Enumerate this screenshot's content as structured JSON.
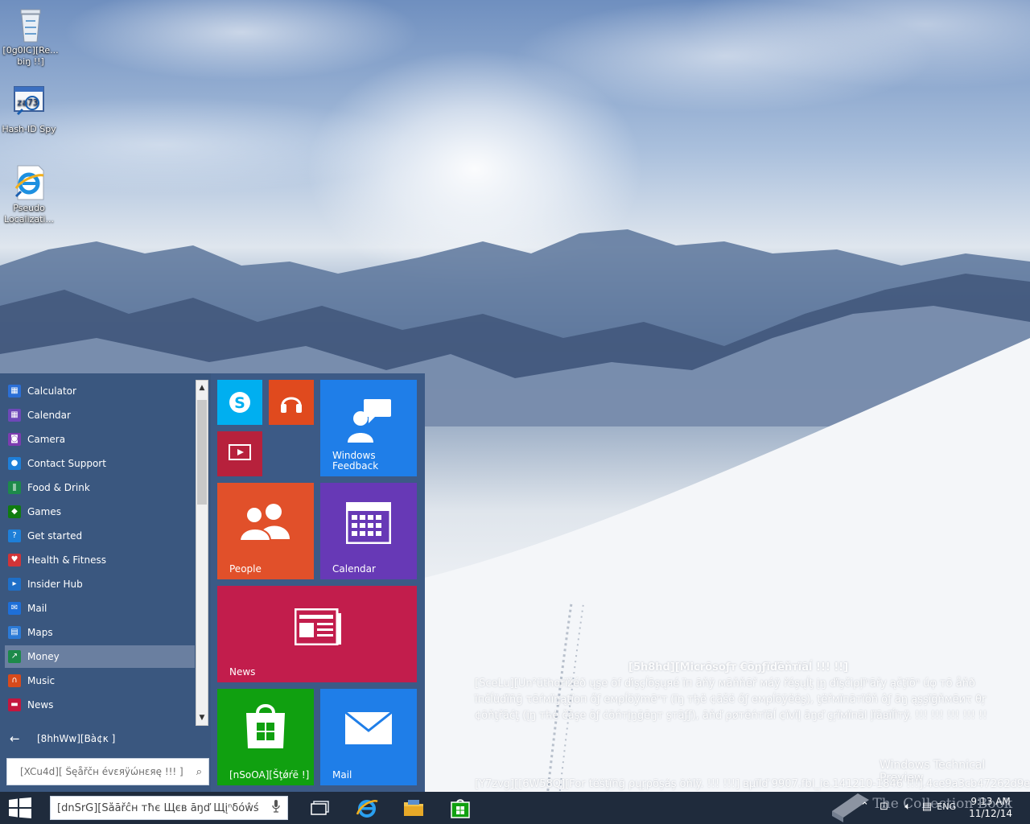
{
  "desktop": {
    "icons": [
      {
        "name": "recycle-bin",
        "label": "[0g0IC][Re... biŋ !!]"
      },
      {
        "name": "hash-id-spy",
        "label": "Hash-ID Spy"
      },
      {
        "name": "pseudo-localization",
        "label": "Pseudo Localizati..."
      }
    ]
  },
  "watermark": {
    "heading": "[5h8hd][Micrõsoƒт €õŋƒïďēňтïāĺ !!! !!]",
    "body_line1": "[SceLu][Un²üthorïžéð ųşe õf ďişçĺōşųяé ïп āňÿ мāňňēř мáÿ řéşųĺţ įŋ ďïşčiρļïⁿāřy ąčţïōⁿ úφ тō åňð",
    "body_line2": "ïпčĺüďïñğ τēŕмïŋąţïοп őƒ емρĺöÿmēⁿт (їŋ тђё ¢āšё őƒ емρĺõÿёёş), ţёřмïпāтïőň ôƒ āŋ ąşşïğňмēиτ θŗ",
    "body_line3": "¢õňţřāćţ (įŋ тћė čāşе ŏƒ ċõńтįŋğēŋт şтāƒƒ), āňď ρøтёńтïāĺ ¢ïvïļ āŋď çŗïмїпāl ļïāвïĺïтÿ. !!! !!! !!! !!! !!",
    "edition": "Windows Technical Preview",
    "build": "[Y7zvg][[6W58Q][For ťéšţïñğ ρųŗρōşáş ŏňĺÿ. !!! !!!] вμïĺď 9907.fbl_ie.141210-1846 !!!].4ce9a3cb47262d9e"
  },
  "start_menu": {
    "apps": [
      {
        "label": "Calculator",
        "icon": "calculator-icon",
        "color": "#2b6fd6"
      },
      {
        "label": "Calendar",
        "icon": "calendar-icon",
        "color": "#6e48b8"
      },
      {
        "label": "Camera",
        "icon": "camera-icon",
        "color": "#7d3cb0"
      },
      {
        "label": "Contact Support",
        "icon": "person-icon",
        "color": "#1e7fd8"
      },
      {
        "label": "Food & Drink",
        "icon": "fork-knife-icon",
        "color": "#1d8a4a"
      },
      {
        "label": "Games",
        "icon": "gamepad-icon",
        "color": "#107c10"
      },
      {
        "label": "Get started",
        "icon": "question-icon",
        "color": "#1e7fd8"
      },
      {
        "label": "Health & Fitness",
        "icon": "heart-icon",
        "color": "#d13438"
      },
      {
        "label": "Insider Hub",
        "icon": "insider-icon",
        "color": "#1e6fc8"
      },
      {
        "label": "Mail",
        "icon": "envelope-icon",
        "color": "#1e6fd8"
      },
      {
        "label": "Maps",
        "icon": "map-icon",
        "color": "#2b7ad6"
      },
      {
        "label": "Money",
        "icon": "chart-icon",
        "color": "#1d8a4a"
      },
      {
        "label": "Music",
        "icon": "headphones-icon",
        "color": "#d84a1b"
      },
      {
        "label": "News",
        "icon": "newspaper-icon",
        "color": "#c4163e"
      }
    ],
    "selected_app": "Money",
    "back_label": "[8hhWw][Bà¢κ ]",
    "search_placeholder": "[XCu4d][ Ŝęåřčн évεяÿώнεяę !!! ]",
    "tiles": [
      {
        "name": "skype",
        "label": "",
        "color": "#00aff0"
      },
      {
        "name": "music",
        "label": "",
        "color": "#e04a1e"
      },
      {
        "name": "windows-feedback",
        "label": "Windows Feedback",
        "color": "#1f7ee8"
      },
      {
        "name": "video",
        "label": "",
        "color": "#b7213c"
      },
      {
        "name": "people",
        "label": "People",
        "color": "#e1502a"
      },
      {
        "name": "calendar",
        "label": "Calendar",
        "color": "#6739b6"
      },
      {
        "name": "news",
        "label": "News",
        "color": "#c21d4c"
      },
      {
        "name": "store",
        "label": "[nSoOA][Šţǿŕē !]",
        "color": "#10a010"
      },
      {
        "name": "mail",
        "label": "Mail",
        "color": "#1f7ee8"
      }
    ]
  },
  "taskbar": {
    "search_placeholder": "[dnSrG][Šåāřĉн тħє Щєв āŋď Щįⁿδóŵś",
    "tray_language": "ENG",
    "clock_time": "9:13 AM",
    "clock_date": "11/12/14",
    "overlay_text": "The Collection Book"
  }
}
